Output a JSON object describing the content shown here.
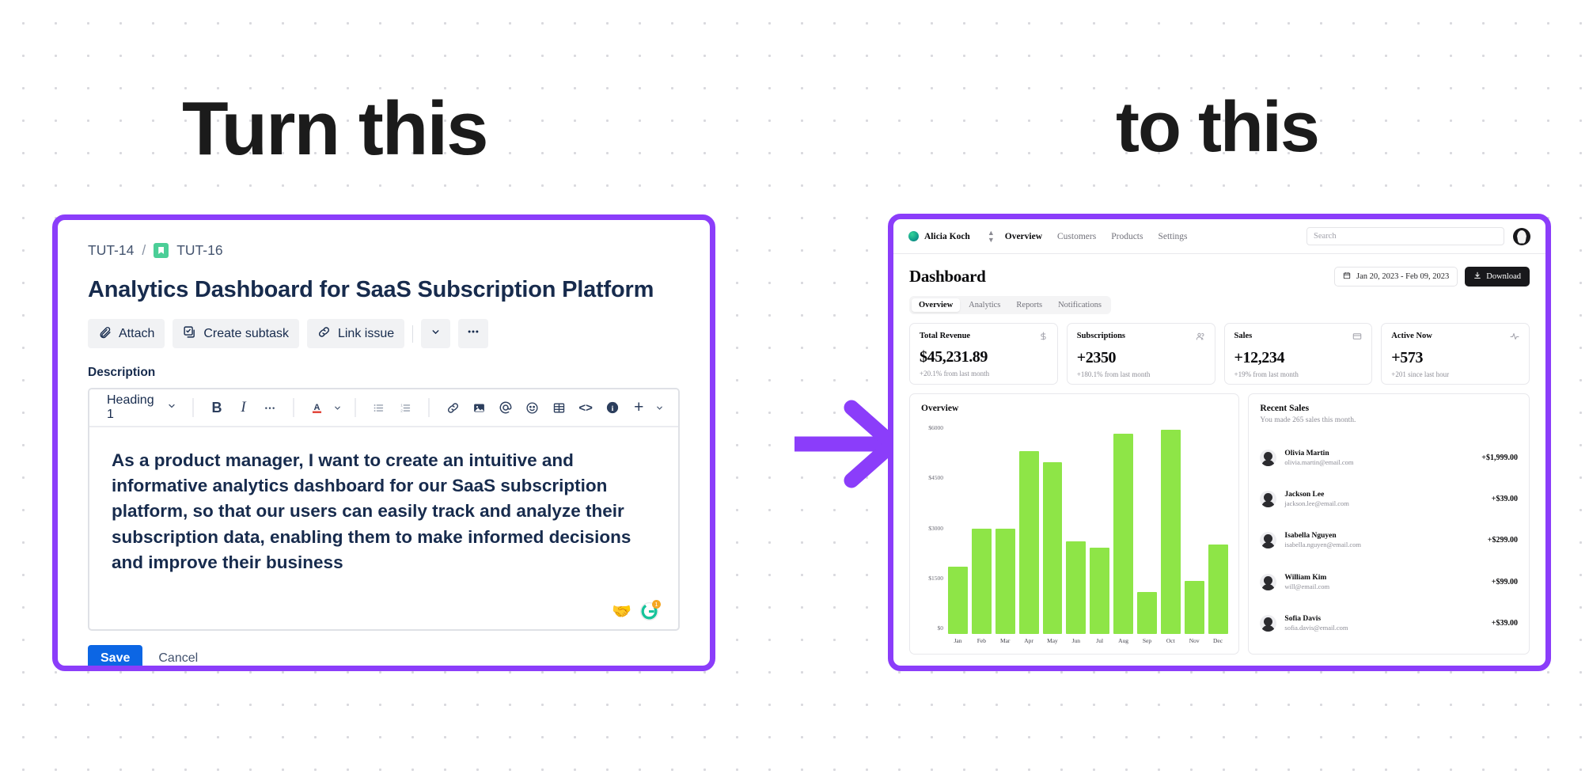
{
  "headings": {
    "left": "Turn this",
    "right": "to this"
  },
  "colors": {
    "frame_purple": "#8b3dfa",
    "arrow_purple": "#8b3dfa",
    "jira_blue": "#0c66e4",
    "chart_green": "#8ee547"
  },
  "jira": {
    "breadcrumb": {
      "parent": "TUT-14",
      "separator": "/",
      "current": "TUT-16",
      "icon": "story-icon"
    },
    "issue_title": "Analytics Dashboard for SaaS Subscription Platform",
    "actions": [
      {
        "label": "Attach",
        "icon": "paperclip-icon"
      },
      {
        "label": "Create subtask",
        "icon": "subtask-icon"
      },
      {
        "label": "Link issue",
        "icon": "link-icon"
      }
    ],
    "action_more": {
      "chevron": "⌄",
      "ellipsis": "•••"
    },
    "description_label": "Description",
    "toolbar": {
      "block_style": "Heading 1",
      "chevron": "⌄",
      "buttons": [
        {
          "name": "bold-icon",
          "glyph": "B"
        },
        {
          "name": "italic-icon",
          "glyph": "I"
        },
        {
          "name": "more-formatting-icon",
          "glyph": "•••"
        },
        {
          "name": "text-color-icon",
          "glyph": "A"
        },
        {
          "name": "bulleted-list-icon",
          "glyph": "list"
        },
        {
          "name": "numbered-list-icon",
          "glyph": "list"
        },
        {
          "name": "link-icon",
          "glyph": "link"
        },
        {
          "name": "image-icon",
          "glyph": "image"
        },
        {
          "name": "mention-icon",
          "glyph": "@"
        },
        {
          "name": "emoji-icon",
          "glyph": "emoji"
        },
        {
          "name": "table-icon",
          "glyph": "table"
        },
        {
          "name": "code-icon",
          "glyph": "<>"
        },
        {
          "name": "info-panel-icon",
          "glyph": "i"
        },
        {
          "name": "insert-more-icon",
          "glyph": "+"
        }
      ]
    },
    "description_text": "As a product manager, I want to create an intuitive and informative analytics dashboard for our SaaS subscription platform, so that our users can easily track and analyze their subscription data, enabling them to make informed decisions and improve their business",
    "badges": [
      {
        "name": "handshake-emoji-icon",
        "glyph": "🤝"
      },
      {
        "name": "grammarly-icon",
        "glyph": "G",
        "count": "1"
      }
    ],
    "save_label": "Save",
    "cancel_label": "Cancel"
  },
  "dashboard": {
    "nav": {
      "brand": "Alicia Koch",
      "links": [
        {
          "label": "Overview",
          "active": true
        },
        {
          "label": "Customers",
          "active": false
        },
        {
          "label": "Products",
          "active": false
        },
        {
          "label": "Settings",
          "active": false
        }
      ],
      "search_placeholder": "Search"
    },
    "title": "Dashboard",
    "date_range": "Jan 20, 2023 - Feb 09, 2023",
    "download_label": "Download",
    "tabs": [
      {
        "label": "Overview",
        "active": true
      },
      {
        "label": "Analytics",
        "active": false
      },
      {
        "label": "Reports",
        "active": false
      },
      {
        "label": "Notifications",
        "active": false
      }
    ],
    "stats": [
      {
        "label": "Total Revenue",
        "value": "$45,231.89",
        "sub": "+20.1% from last month",
        "icon": "dollar-icon"
      },
      {
        "label": "Subscriptions",
        "value": "+2350",
        "sub": "+180.1% from last month",
        "icon": "users-icon"
      },
      {
        "label": "Sales",
        "value": "+12,234",
        "sub": "+19% from last month",
        "icon": "credit-card-icon"
      },
      {
        "label": "Active Now",
        "value": "+573",
        "sub": "+201 since last hour",
        "icon": "activity-icon"
      }
    ],
    "overview_panel_title": "Overview",
    "recent_sales": {
      "title": "Recent Sales",
      "subtitle": "You made 265 sales this month.",
      "rows": [
        {
          "name": "Olivia Martin",
          "email": "olivia.martin@email.com",
          "amount": "+$1,999.00"
        },
        {
          "name": "Jackson Lee",
          "email": "jackson.lee@email.com",
          "amount": "+$39.00"
        },
        {
          "name": "Isabella Nguyen",
          "email": "isabella.nguyen@email.com",
          "amount": "+$299.00"
        },
        {
          "name": "William Kim",
          "email": "will@email.com",
          "amount": "+$99.00"
        },
        {
          "name": "Sofia Davis",
          "email": "sofia.davis@email.com",
          "amount": "+$39.00"
        }
      ]
    }
  },
  "chart_data": {
    "type": "bar",
    "title": "Overview",
    "categories": [
      "Jan",
      "Feb",
      "Mar",
      "Apr",
      "May",
      "Jun",
      "Jul",
      "Aug",
      "Sep",
      "Oct",
      "Nov",
      "Dec"
    ],
    "values": [
      2000,
      3120,
      3110,
      5400,
      5070,
      2740,
      2550,
      5930,
      1250,
      6030,
      1570,
      2650
    ],
    "ytick_labels": [
      "$6000",
      "$4500",
      "$3000",
      "$1500",
      "$0"
    ],
    "ylim": [
      0,
      6200
    ],
    "xlabel": "",
    "ylabel": "",
    "grid": false,
    "legend": false,
    "bar_color": "#8ee547"
  }
}
